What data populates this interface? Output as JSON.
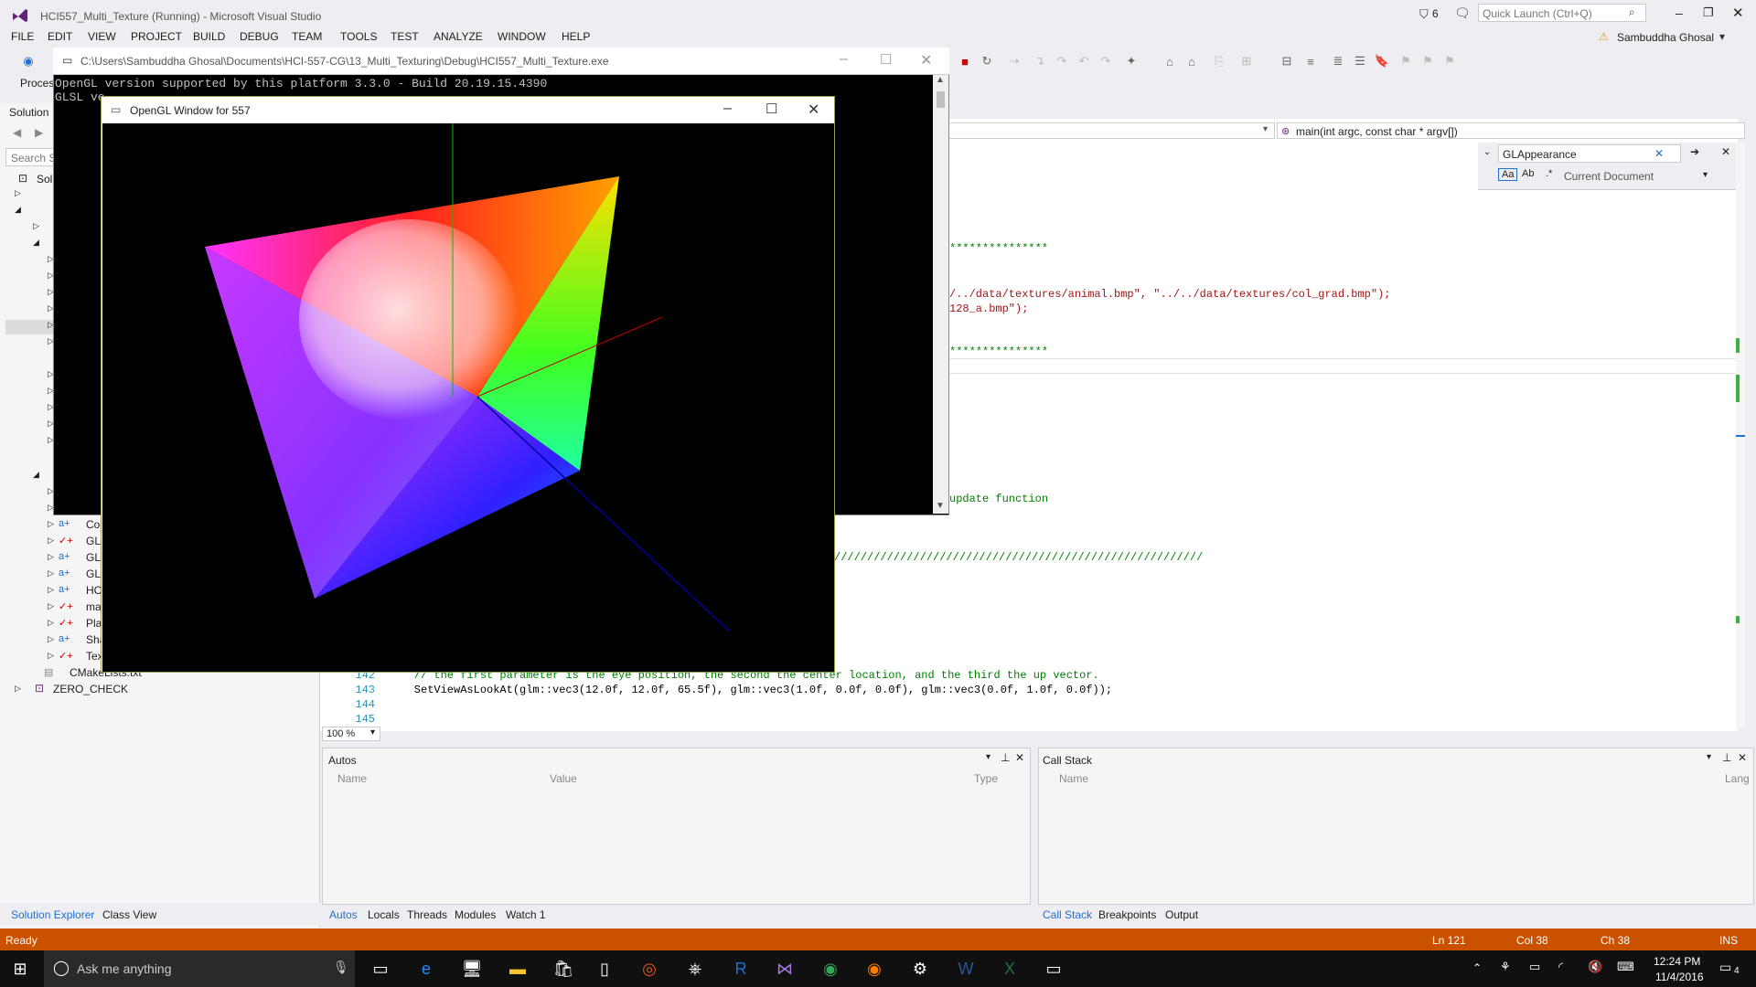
{
  "vs": {
    "title": "HCI557_Multi_Texture (Running) - Microsoft Visual Studio",
    "notifications": "6",
    "quick_launch": "Quick Launch (Ctrl+Q)",
    "user": "Sambuddha Ghosal",
    "menu": [
      "FILE",
      "EDIT",
      "VIEW",
      "PROJECT",
      "BUILD",
      "DEBUG",
      "TEAM",
      "TOOLS",
      "TEST",
      "ANALYZE",
      "WINDOW",
      "HELP"
    ],
    "process_label": "Proces",
    "solution_label": "Solution",
    "search_solution": "Search So",
    "navbar_member": "main(int argc, const char * argv[])",
    "find_text": "GLAppearance",
    "find_scope": "Current Document"
  },
  "solution_tree": {
    "items": [
      "Solu",
      "Coc",
      "GL/",
      "GLC",
      "GLS",
      "HCI",
      "ma",
      "Pla",
      "Sha",
      "Tex",
      "CMakeLists.txt",
      "ZERO_CHECK"
    ]
  },
  "code": {
    "lines": [
      {
        "num": "",
        "text": "***************"
      },
      {
        "num": "",
        "text": "/../data/textures/animal.bmp\", \"../../data/textures/col_grad.bmp\");"
      },
      {
        "num": "",
        "text": "128_a.bmp\");"
      },
      {
        "num": "",
        "text": "***************"
      },
      {
        "num": "",
        "text": "update function"
      },
      {
        "num": "",
        "text": "////////////////////////////////////////////////////////"
      },
      {
        "num": "142",
        "text": "    // the first parameter is the eye position, the second the center location, and the third the up vector."
      },
      {
        "num": "143",
        "text": "    SetViewAsLookAt(glm::vec3(12.0f, 12.0f, 65.5f), glm::vec3(1.0f, 0.0f, 0.0f), glm::vec3(0.0f, 1.0f, 0.0f));"
      },
      {
        "num": "144",
        "text": ""
      },
      {
        "num": "145",
        "text": ""
      }
    ],
    "zoom": "100 %"
  },
  "console": {
    "title": "C:\\Users\\Sambuddha Ghosal\\Documents\\HCI-557-CG\\13_Multi_Texturing\\Debug\\HCI557_Multi_Texture.exe",
    "line1": "OpenGL version supported by this platform 3.3.0 - Build 20.19.15.4390",
    "line2": "GLSL ve"
  },
  "glwindow": {
    "title": "OpenGL Window for 557"
  },
  "autos": {
    "title": "Autos",
    "columns": [
      "Name",
      "Value",
      "Type"
    ]
  },
  "callstack": {
    "title": "Call Stack",
    "columns": [
      "Name",
      "Lang"
    ]
  },
  "bottom_tabs_left": [
    "Solution Explorer",
    "Class View"
  ],
  "bottom_tabs_mid": [
    "Autos",
    "Locals",
    "Threads",
    "Modules",
    "Watch 1"
  ],
  "bottom_tabs_right": [
    "Call Stack",
    "Breakpoints",
    "Output"
  ],
  "status": {
    "left": "Ready",
    "ln": "Ln 121",
    "col": "Col 38",
    "ch": "Ch 38",
    "ins": "INS"
  },
  "taskbar": {
    "search": "Ask me anything",
    "time": "12:24 PM",
    "date": "11/4/2016",
    "notif_count": "4"
  }
}
